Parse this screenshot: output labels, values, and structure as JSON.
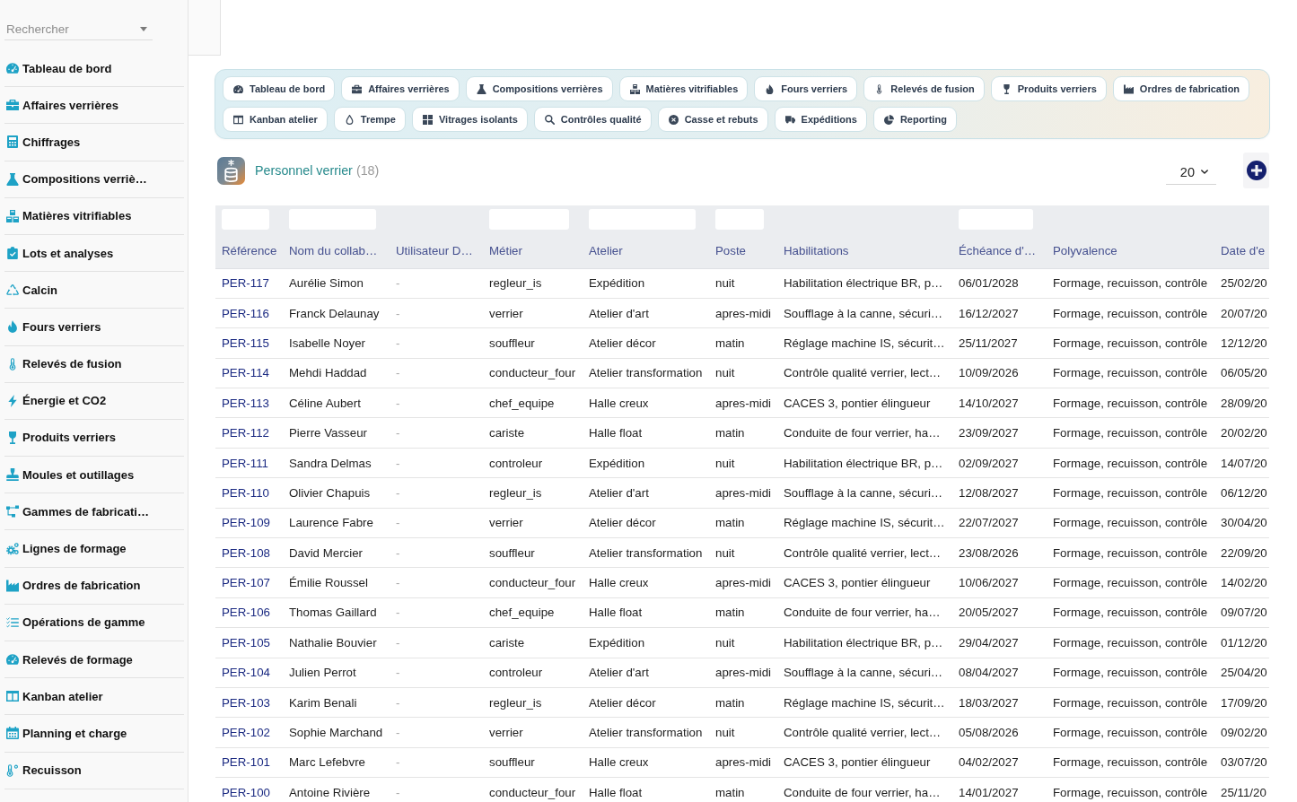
{
  "sidebar": {
    "search": {
      "placeholder": "Rechercher"
    },
    "items": [
      {
        "label": "Tableau de bord",
        "selected": false
      },
      {
        "label": "Affaires verrières",
        "selected": false
      },
      {
        "label": "Chiffrages",
        "selected": false
      },
      {
        "label": "Compositions verriè…",
        "selected": false
      },
      {
        "label": "Matières vitrifiables",
        "selected": false
      },
      {
        "label": "Lots et analyses",
        "selected": false
      },
      {
        "label": "Calcin",
        "selected": false
      },
      {
        "label": "Fours verriers",
        "selected": false
      },
      {
        "label": "Relevés de fusion",
        "selected": false
      },
      {
        "label": "Énergie et CO2",
        "selected": false
      },
      {
        "label": "Produits verriers",
        "selected": false
      },
      {
        "label": "Moules et outillages",
        "selected": false
      },
      {
        "label": "Gammes de fabricati…",
        "selected": false
      },
      {
        "label": "Lignes de formage",
        "selected": false
      },
      {
        "label": "Ordres de fabrication",
        "selected": false
      },
      {
        "label": "Opérations de gamme",
        "selected": false
      },
      {
        "label": "Relevés de formage",
        "selected": false
      },
      {
        "label": "Kanban atelier",
        "selected": false
      },
      {
        "label": "Planning et charge",
        "selected": false
      },
      {
        "label": "Recuisson",
        "selected": false
      }
    ]
  },
  "shortcut_tabs": [
    {
      "label": "Tableau de bord",
      "selected": false
    },
    {
      "label": "Affaires verrières",
      "selected": false
    },
    {
      "label": "Compositions verrières",
      "selected": false
    },
    {
      "label": "Matières vitrifiables",
      "selected": false
    },
    {
      "label": "Fours verriers",
      "selected": false
    },
    {
      "label": "Relevés de fusion",
      "selected": false
    },
    {
      "label": "Produits verriers",
      "selected": false
    },
    {
      "label": "Ordres de fabrication",
      "selected": false
    },
    {
      "label": "Kanban atelier",
      "selected": false
    },
    {
      "label": "Trempe",
      "selected": false
    },
    {
      "label": "Vitrages isolants",
      "selected": false
    },
    {
      "label": "Contrôles qualité",
      "selected": false
    },
    {
      "label": "Casse et rebuts",
      "selected": false
    },
    {
      "label": "Expéditions",
      "selected": false
    },
    {
      "label": "Reporting",
      "selected": false
    }
  ],
  "list": {
    "title": "Personnel verrier",
    "count": "(18)",
    "page_size": "20",
    "table": {
      "columns": [
        {
          "label": "Référence",
          "filter": true,
          "kind": "link"
        },
        {
          "label": "Nom du collab…",
          "filter": true,
          "kind": "text"
        },
        {
          "label": "Utilisateur D…",
          "filter": false,
          "kind": "muted"
        },
        {
          "label": "Métier",
          "filter": true,
          "kind": "text"
        },
        {
          "label": "Atelier",
          "filter": true,
          "kind": "text"
        },
        {
          "label": "Poste",
          "filter": true,
          "kind": "text"
        },
        {
          "label": "Habilitations",
          "filter": false,
          "kind": "text"
        },
        {
          "label": "Échéance d'…",
          "filter": true,
          "kind": "text"
        },
        {
          "label": "Polyvalence",
          "filter": false,
          "kind": "text"
        },
        {
          "label": "Date d'e",
          "filter": false,
          "kind": "text"
        }
      ],
      "rows": [
        [
          "PER-117",
          "Aurélie Simon",
          "-",
          "regleur_is",
          "Expédition",
          "nuit",
          "Habilitation électrique BR, p…",
          "06/01/2028",
          "Formage, recuisson, contrôle",
          "25/02/20"
        ],
        [
          "PER-116",
          "Franck Delaunay",
          "-",
          "verrier",
          "Atelier d'art",
          "apres-midi",
          "Soufflage à la canne, sécuri…",
          "16/12/2027",
          "Formage, recuisson, contrôle",
          "20/07/20"
        ],
        [
          "PER-115",
          "Isabelle Noyer",
          "-",
          "souffleur",
          "Atelier décor",
          "matin",
          "Réglage machine IS, sécurit…",
          "25/11/2027",
          "Formage, recuisson, contrôle",
          "12/12/20"
        ],
        [
          "PER-114",
          "Mehdi Haddad",
          "-",
          "conducteur_four",
          "Atelier transformation",
          "nuit",
          "Contrôle qualité verrier, lect…",
          "10/09/2026",
          "Formage, recuisson, contrôle",
          "06/05/20"
        ],
        [
          "PER-113",
          "Céline Aubert",
          "-",
          "chef_equipe",
          "Halle creux",
          "apres-midi",
          "CACES 3, pontier élingueur",
          "14/10/2027",
          "Formage, recuisson, contrôle",
          "28/09/20"
        ],
        [
          "PER-112",
          "Pierre Vasseur",
          "-",
          "cariste",
          "Halle float",
          "matin",
          "Conduite de four verrier, ha…",
          "23/09/2027",
          "Formage, recuisson, contrôle",
          "20/02/20"
        ],
        [
          "PER-111",
          "Sandra Delmas",
          "-",
          "controleur",
          "Expédition",
          "nuit",
          "Habilitation électrique BR, p…",
          "02/09/2027",
          "Formage, recuisson, contrôle",
          "14/07/20"
        ],
        [
          "PER-110",
          "Olivier Chapuis",
          "-",
          "regleur_is",
          "Atelier d'art",
          "apres-midi",
          "Soufflage à la canne, sécuri…",
          "12/08/2027",
          "Formage, recuisson, contrôle",
          "06/12/20"
        ],
        [
          "PER-109",
          "Laurence Fabre",
          "-",
          "verrier",
          "Atelier décor",
          "matin",
          "Réglage machine IS, sécurit…",
          "22/07/2027",
          "Formage, recuisson, contrôle",
          "30/04/20"
        ],
        [
          "PER-108",
          "David Mercier",
          "-",
          "souffleur",
          "Atelier transformation",
          "nuit",
          "Contrôle qualité verrier, lect…",
          "23/08/2026",
          "Formage, recuisson, contrôle",
          "22/09/20"
        ],
        [
          "PER-107",
          "Émilie Roussel",
          "-",
          "conducteur_four",
          "Halle creux",
          "apres-midi",
          "CACES 3, pontier élingueur",
          "10/06/2027",
          "Formage, recuisson, contrôle",
          "14/02/20"
        ],
        [
          "PER-106",
          "Thomas Gaillard",
          "-",
          "chef_equipe",
          "Halle float",
          "matin",
          "Conduite de four verrier, ha…",
          "20/05/2027",
          "Formage, recuisson, contrôle",
          "09/07/20"
        ],
        [
          "PER-105",
          "Nathalie Bouvier",
          "-",
          "cariste",
          "Expédition",
          "nuit",
          "Habilitation électrique BR, p…",
          "29/04/2027",
          "Formage, recuisson, contrôle",
          "01/12/20"
        ],
        [
          "PER-104",
          "Julien Perrot",
          "-",
          "controleur",
          "Atelier d'art",
          "apres-midi",
          "Soufflage à la canne, sécuri…",
          "08/04/2027",
          "Formage, recuisson, contrôle",
          "25/04/20"
        ],
        [
          "PER-103",
          "Karim Benali",
          "-",
          "regleur_is",
          "Atelier décor",
          "matin",
          "Réglage machine IS, sécurit…",
          "18/03/2027",
          "Formage, recuisson, contrôle",
          "17/09/20"
        ],
        [
          "PER-102",
          "Sophie Marchand",
          "-",
          "verrier",
          "Atelier transformation",
          "nuit",
          "Contrôle qualité verrier, lect…",
          "05/08/2026",
          "Formage, recuisson, contrôle",
          "09/02/20"
        ],
        [
          "PER-101",
          "Marc Lefebvre",
          "-",
          "souffleur",
          "Halle creux",
          "apres-midi",
          "CACES 3, pontier élingueur",
          "04/02/2027",
          "Formage, recuisson, contrôle",
          "03/07/20"
        ],
        [
          "PER-100",
          "Antoine Rivière",
          "-",
          "conducteur_four",
          "Halle float",
          "matin",
          "Conduite de four verrier, ha…",
          "14/01/2027",
          "Formage, recuisson, contrôle",
          "25/11/20"
        ]
      ]
    }
  }
}
